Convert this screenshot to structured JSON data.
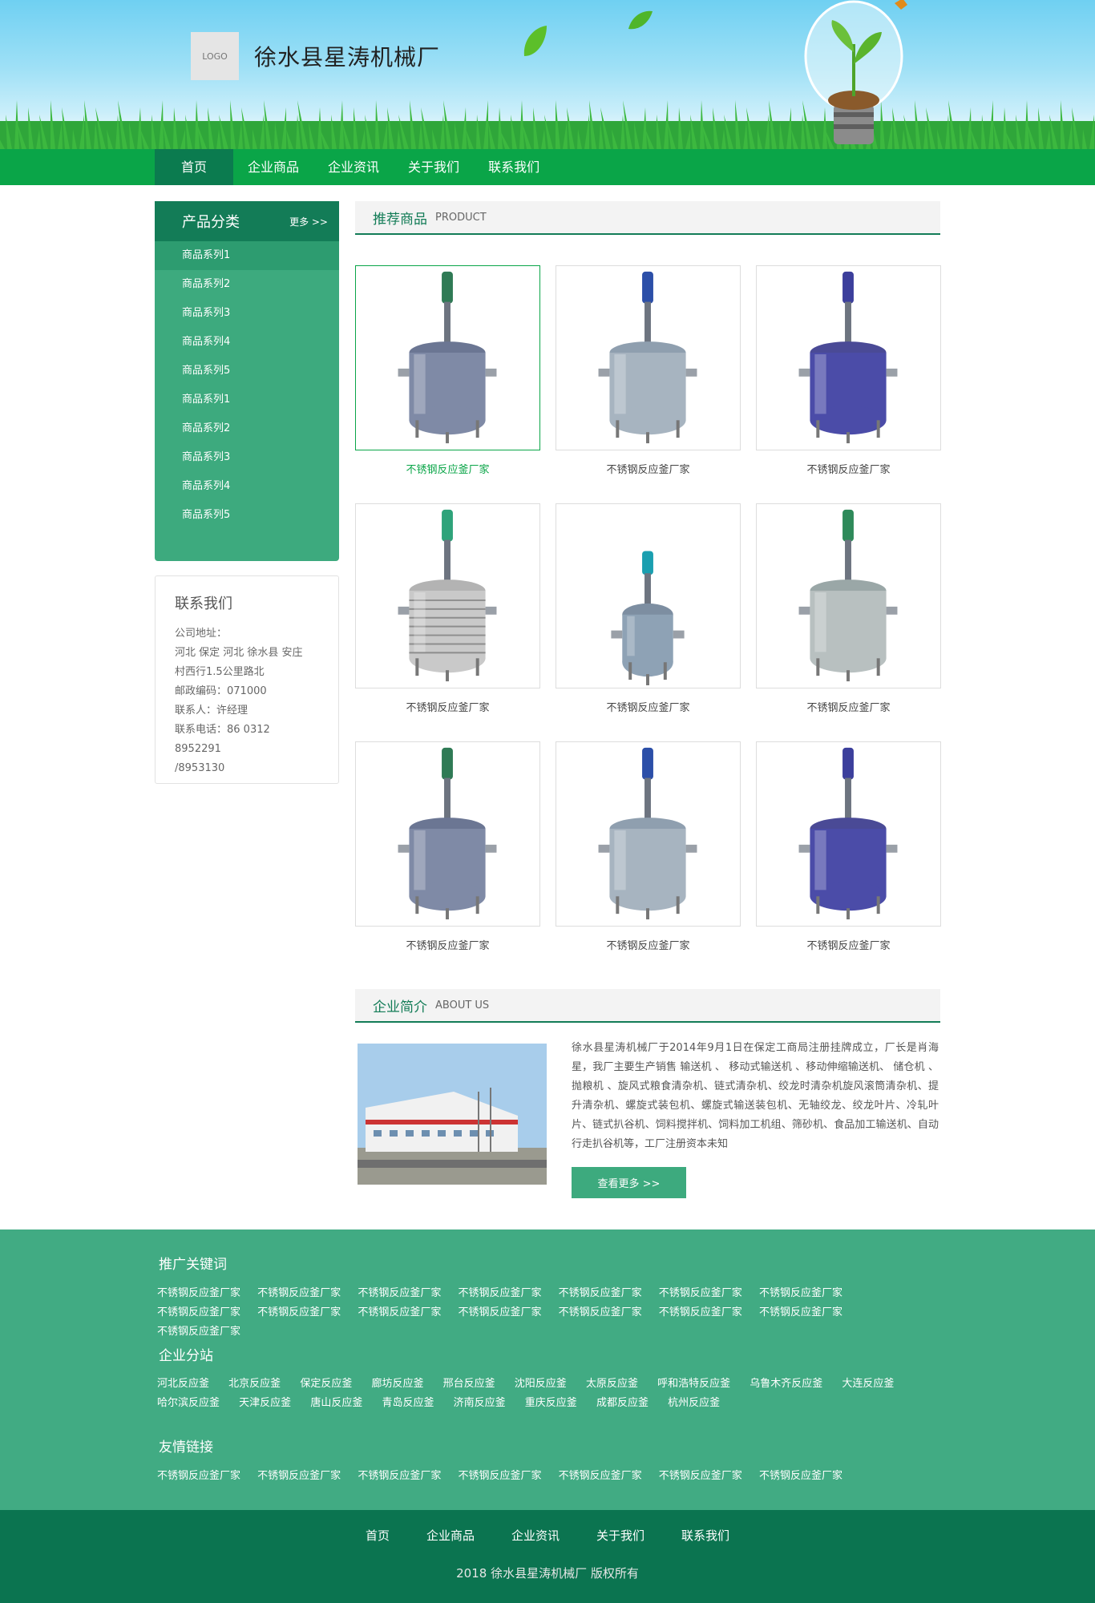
{
  "header": {
    "logo_text": "LOGO",
    "site_title": "徐水县星涛机械厂"
  },
  "nav": {
    "items": [
      "首页",
      "企业商品",
      "企业资讯",
      "关于我们",
      "联系我们"
    ],
    "active": 0
  },
  "sidebar": {
    "title": "产品分类",
    "more": "更多 >>",
    "items": [
      "商品系列1",
      "商品系列2",
      "商品系列3",
      "商品系列4",
      "商品系列5",
      "商品系列1",
      "商品系列2",
      "商品系列3",
      "商品系列4",
      "商品系列5"
    ]
  },
  "contact": {
    "title": "联系我们",
    "lines": [
      "公司地址：",
      "河北 保定 河北 徐水县 安庄",
      "村西行1.5公里路北",
      "邮政编码：071000",
      "联系人：许经理",
      "联系电话：86 0312 8952291",
      "/8953130"
    ]
  },
  "products": {
    "title_cn": "推荐商品",
    "title_en": "PRODUCT",
    "items": [
      {
        "name": "不锈钢反应釜厂家",
        "style": "grey-green"
      },
      {
        "name": "不锈钢反应釜厂家",
        "style": "silver-blue"
      },
      {
        "name": "不锈钢反应釜厂家",
        "style": "purple"
      },
      {
        "name": "不锈钢反应釜厂家",
        "style": "coil"
      },
      {
        "name": "不锈钢反应釜厂家",
        "style": "small-cyan"
      },
      {
        "name": "不锈钢反应釜厂家",
        "style": "silver-green"
      },
      {
        "name": "不锈钢反应釜厂家",
        "style": "grey-green"
      },
      {
        "name": "不锈钢反应釜厂家",
        "style": "silver-blue"
      },
      {
        "name": "不锈钢反应釜厂家",
        "style": "purple"
      }
    ]
  },
  "about": {
    "title_cn": "企业简介",
    "title_en": "ABOUT US",
    "text": "徐水县星涛机械厂于2014年9月1日在保定工商局注册挂牌成立，厂长是肖海星，我厂主要生产销售 输送机 、 移动式输送机 、移动伸缩输送机、 储仓机 、 抛粮机 、旋风式粮食清杂机、链式清杂机、绞龙时清杂机旋风滚筒清杂机、提升清杂机、螺旋式装包机、螺旋式输送装包机、无轴绞龙、绞龙叶片、冷轧叶片、链式扒谷机、饲料搅拌机、饲料加工机组、筛砂机、食品加工输送机、自动行走扒谷机等，工厂注册资本未知",
    "button": "查看更多 >>"
  },
  "footer": {
    "keywords_title": "推广关键词",
    "keywords": [
      "不锈钢反应釜厂家",
      "不锈钢反应釜厂家",
      "不锈钢反应釜厂家",
      "不锈钢反应釜厂家",
      "不锈钢反应釜厂家",
      "不锈钢反应釜厂家",
      "不锈钢反应釜厂家",
      "不锈钢反应釜厂家",
      "不锈钢反应釜厂家",
      "不锈钢反应釜厂家",
      "不锈钢反应釜厂家",
      "不锈钢反应釜厂家",
      "不锈钢反应釜厂家",
      "不锈钢反应釜厂家",
      "不锈钢反应釜厂家"
    ],
    "branches_title": "企业分站",
    "branches": [
      "河北反应釜",
      "北京反应釜",
      "保定反应釜",
      "廊坊反应釜",
      "邢台反应釜",
      "沈阳反应釜",
      "太原反应釜",
      "呼和浩特反应釜",
      "乌鲁木齐反应釜",
      "大连反应釜",
      "哈尔滨反应釜",
      "天津反应釜",
      "唐山反应釜",
      "青岛反应釜",
      "济南反应釜",
      "重庆反应釜",
      "成都反应釜",
      "杭州反应釜"
    ],
    "links_title": "友情链接",
    "links": [
      "不锈钢反应釜厂家",
      "不锈钢反应釜厂家",
      "不锈钢反应釜厂家",
      "不锈钢反应釜厂家",
      "不锈钢反应釜厂家",
      "不锈钢反应釜厂家",
      "不锈钢反应釜厂家"
    ],
    "nav": [
      "首页",
      "企业商品",
      "企业资讯",
      "关于我们",
      "联系我们"
    ],
    "copyright": "2018 徐水县星涛机械厂 版权所有"
  },
  "colors": {
    "nav_green": "#0aa548",
    "dark_green": "#137c57",
    "side_green": "#3daa7e",
    "footer_green": "#41ab83",
    "footer_dark": "#0b7450"
  }
}
